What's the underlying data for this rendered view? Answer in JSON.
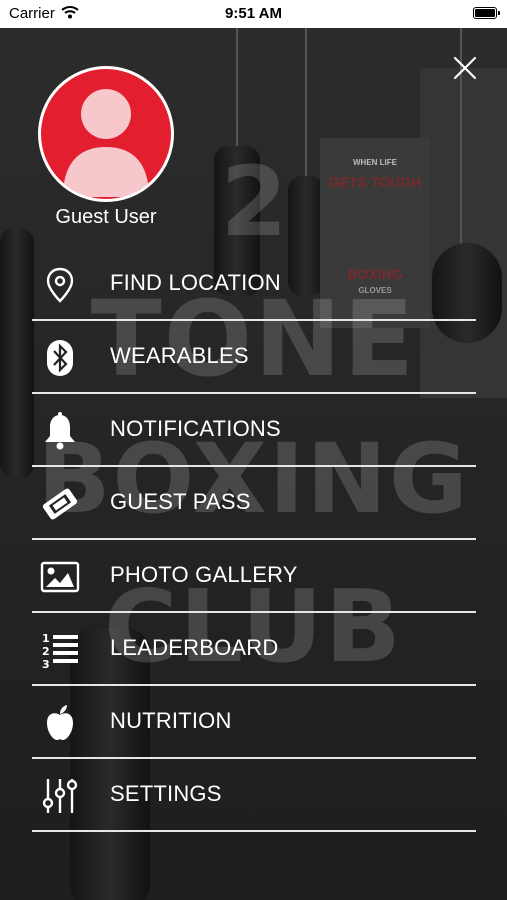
{
  "status_bar": {
    "carrier": "Carrier",
    "time": "9:51 AM"
  },
  "background": {
    "watermark_lines": [
      "2",
      "TONE",
      "BOXING",
      "CLUB"
    ],
    "poster_lines": [
      "WHEN LIFE",
      "GETS TOUGH",
      "BOXING",
      "GLOVES"
    ]
  },
  "profile": {
    "name": "Guest User",
    "avatar_color": "#e31e2f"
  },
  "menu": {
    "items": [
      {
        "label": "FIND LOCATION",
        "icon": "location-pin-icon"
      },
      {
        "label": "WEARABLES",
        "icon": "bluetooth-icon"
      },
      {
        "label": "NOTIFICATIONS",
        "icon": "bell-icon"
      },
      {
        "label": "GUEST PASS",
        "icon": "ticket-icon"
      },
      {
        "label": "PHOTO GALLERY",
        "icon": "image-icon"
      },
      {
        "label": "LEADERBOARD",
        "icon": "numbered-list-icon"
      },
      {
        "label": "NUTRITION",
        "icon": "apple-icon"
      },
      {
        "label": "SETTINGS",
        "icon": "sliders-icon"
      }
    ]
  }
}
